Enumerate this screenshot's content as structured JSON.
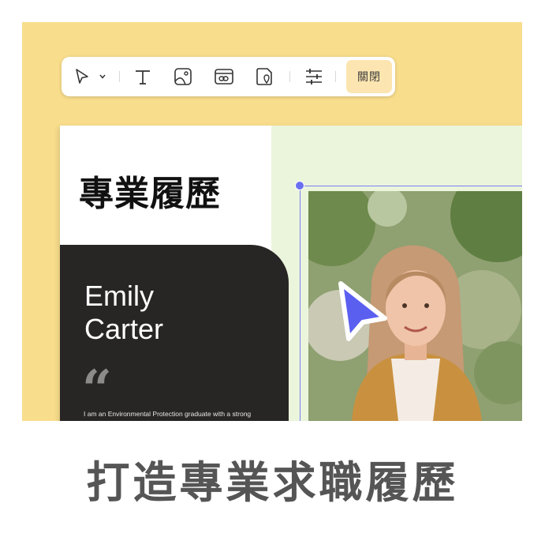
{
  "toolbar": {
    "tools": [
      "select",
      "text",
      "image",
      "link",
      "location",
      "adjust"
    ],
    "icons": [
      "pointer-icon",
      "chevron-down-icon",
      "text-icon",
      "image-icon",
      "link-card-icon",
      "location-pin-icon",
      "sliders-icon"
    ],
    "close_label": "關閉"
  },
  "resume": {
    "title": "專業履歷",
    "first_name": "Emily",
    "last_name": "Carter",
    "quote_glyph": "“",
    "bio": "I am an Environmental Protection graduate with a strong"
  },
  "caption": "打造專業求職履歷",
  "colors": {
    "background": "#f8dd8c",
    "dark_card": "#282624",
    "accent": "#6b6ff0",
    "close_button": "#fce5b0",
    "panel_green": "#ebf5dc"
  }
}
